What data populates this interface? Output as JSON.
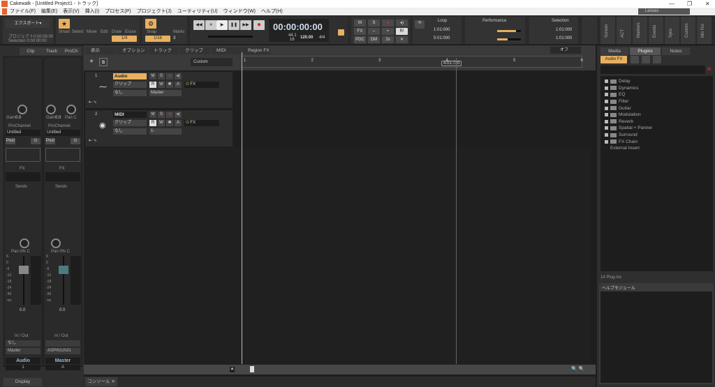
{
  "window": {
    "title": "Cakewalk - [Untitled Project1 - トラック]",
    "minimize": "—",
    "maximize": "❐",
    "close": "✕"
  },
  "menu": [
    "ファイル(F)",
    "編集(E)",
    "表示(V)",
    "挿入(I)",
    "プロセス(P)",
    "プロジェクト(J)",
    "ユーティリティ(U)",
    "ウィンドウ(W)",
    "ヘルプ(H)"
  ],
  "workspace": "Lenses",
  "control": {
    "export": "エクスポート▾",
    "project_range": "プロジェクト0:00:00:00",
    "selection_range": "Selection 0:00:00:00",
    "tools": [
      "Smart",
      "Select",
      "Move",
      "Edit",
      "Draw",
      "Erase"
    ],
    "tool_snap": "1/4",
    "snap_label": "Snap",
    "marks_label": "Marks",
    "snap_value": "1/16",
    "snap_count": "3",
    "time": "00:00:00:00",
    "sample_rate": "44.1",
    "bit_depth": "16",
    "tempo": "120.00",
    "meter": "4/4",
    "mix_buttons": [
      "M",
      "S",
      "●",
      "◂)",
      "FX",
      "⇔",
      "≈",
      "R!",
      "PDC",
      "DM",
      "2x",
      "✕"
    ],
    "loop": {
      "title": "Loop",
      "start": "1:01:000",
      "end": "5:01:000"
    },
    "performance": {
      "title": "Performance",
      "cpu_percent": 80,
      "disk_percent": 45,
      "scale": [
        "0%",
        "50%",
        "100%"
      ]
    },
    "selection": {
      "title": "Selection",
      "start": "1:01:000",
      "end": "1:01:000"
    },
    "views": [
      "Screen",
      "ACT",
      "Markers",
      "Events",
      "Sync",
      "Custom",
      "Mix Rcl"
    ]
  },
  "inspector": {
    "tabs": [
      "Clip",
      "Track",
      "ProCh"
    ],
    "strips": [
      {
        "gain": "Gain",
        "gain_val": "0.0",
        "pan": "",
        "prochannel": "ProChannel",
        "preset": "Untitled",
        "post": "Post",
        "fx": "FX",
        "sends": "Sends",
        "pan_label": "Pan 0% C",
        "level": "0.0",
        "in_out": "In / Out",
        "input": "なし",
        "output": "Master",
        "name": "Audio",
        "number": "1"
      },
      {
        "gain": "Gain",
        "gain_val": "0.0",
        "pan": "Pan C",
        "prochannel": "ProChannel",
        "preset": "Untitled",
        "post": "Post",
        "fx": "FX",
        "sends": "Sends",
        "pan_label": "Pan 0% C",
        "level": "0.0",
        "in_out": "In / Out",
        "input": "",
        "output": "ASPrfcUA31",
        "name": "Master",
        "number": "A"
      }
    ],
    "scale": [
      "6",
      "0",
      "-6",
      "-12",
      "-18",
      "-24",
      "-36",
      "-oo"
    ],
    "display": "Display"
  },
  "trackview": {
    "menus": [
      "表示",
      "オプション",
      "トラック",
      "クリップ",
      "MIDI",
      "Region FX"
    ],
    "filter": "Custom",
    "snap_off": "オフ",
    "ruler": [
      "1",
      "2",
      "3",
      "4",
      "5",
      "6"
    ],
    "cursor_time": "4:01:720",
    "tracks": [
      {
        "num": "1",
        "name": "Audio",
        "clip": "クリップ",
        "input": "なし",
        "output": "Master",
        "fx": "FX"
      },
      {
        "num": "2",
        "name": "MIDI",
        "clip": "クリップ",
        "input": "なし",
        "output": "1-",
        "fx": "FX"
      }
    ],
    "btns": [
      "M",
      "S",
      "R",
      "W",
      "A"
    ]
  },
  "browser": {
    "tabs": [
      "Media",
      "Plugins",
      "Notes"
    ],
    "category": "Audio FX",
    "folders": [
      "Delay",
      "Dynamics",
      "EQ",
      "Filter",
      "Guitar",
      "Modulation",
      "Reverb",
      "Spatial + Panner",
      "Surround",
      "FX Chain"
    ],
    "external": "External Insert",
    "count": "14 Plug-ins",
    "help_title": "ヘルプモジュール"
  },
  "console_tab": "コンソール"
}
